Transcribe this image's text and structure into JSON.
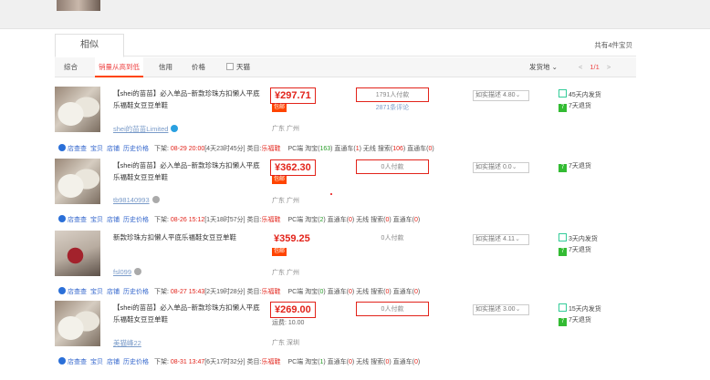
{
  "header": {
    "tab_similar": "相似",
    "total": "共有4件宝贝"
  },
  "sortbar": {
    "items": [
      "综合",
      "销量从高到低",
      "信用",
      "价格",
      "天猫"
    ],
    "ship_from": "发货地",
    "ship_caret": "⌄",
    "pager_prev": "<",
    "pager_current": "1/1",
    "pager_next": ">"
  },
  "items": [
    {
      "title": "【shei的苗苗】必入单品~新款珍珠方扣懒人平底乐福鞋女豆豆单鞋",
      "shop": "shei的苗苗Limited",
      "price": "¥297.71",
      "badge": "包邮",
      "location": "广东 广州",
      "sales": "1791人付款",
      "reviews": "2871条评论",
      "dsr": "如实描述 4.80",
      "services": [
        "45天内发货",
        "7天退货"
      ]
    },
    {
      "title": "【shei的苗苗】必入单品~新款珍珠方扣懒人平底乐福鞋女豆豆单鞋",
      "shop": "tb98140993",
      "price": "¥362.30",
      "badge": "包邮",
      "location": "广东 广州",
      "sales": "0人付款",
      "reviews": "",
      "dsr": "如实描述 0.0",
      "services": [
        "7天退货"
      ]
    },
    {
      "title": "新款珍珠方扣懒人平底乐福鞋女豆豆单鞋",
      "shop": "fsl099",
      "price": "¥359.25",
      "badge": "包邮",
      "location": "广东 广州",
      "sales": "0人付款",
      "reviews": "",
      "dsr": "如实描述 4.11",
      "services": [
        "3天内发货",
        "7天退货"
      ]
    },
    {
      "title": "【shei的苗苗】必入单品~新款珍珠方扣懒人平底乐福鞋女豆豆单鞋",
      "shop": "美猫峰22",
      "price": "¥269.00",
      "freight": "运费: 10.00",
      "location": "广东 深圳",
      "sales": "0人付款",
      "reviews": "",
      "dsr": "如实描述 3.00",
      "services": [
        "15天内发货",
        "7天退货"
      ]
    }
  ],
  "tools": {
    "labels": [
      "店查查",
      "宝贝",
      "店铺",
      "历史价格"
    ],
    "posted_label": "下架:",
    "category_label": "类目:",
    "category": "乐福鞋",
    "rows": [
      {
        "down_time": "08-29 20:00",
        "duration": "[4天23时45分]",
        "pc_label": "PC端 淘宝(",
        "pc_val": "163",
        "zt_label": ") 直通车(",
        "zt_val": "1",
        "ws_label": ") 无线 搜索(",
        "ws_val": "106",
        "ws_zt_label": ") 直通车(",
        "ws_zt_val": "0"
      },
      {
        "down_time": "08-26 15:12",
        "duration": "[1天18时57分]",
        "pc_label": "PC端 淘宝(",
        "pc_val": "2",
        "zt_label": ") 直通车(",
        "zt_val": "0",
        "ws_label": ") 无线 搜索(",
        "ws_val": "0",
        "ws_zt_label": ") 直通车(",
        "ws_zt_val": "0"
      },
      {
        "down_time": "08-27 15:43",
        "duration": "[2天19时28分]",
        "pc_label": "PC端 淘宝(",
        "pc_val": "0",
        "zt_label": ") 直通车(",
        "zt_val": "0",
        "ws_label": ") 无线 搜索(",
        "ws_val": "0",
        "ws_zt_label": ") 直通车(",
        "ws_zt_val": "0"
      },
      {
        "down_time": "08-31 13:47",
        "duration": "[6天17时32分]",
        "pc_label": "PC端 淘宝(",
        "pc_val": "1",
        "zt_label": ") 直通车(",
        "zt_val": "0",
        "ws_label": ") 无线 搜索(",
        "ws_val": "0",
        "ws_zt_label": ") 直通车(",
        "ws_zt_val": "0"
      }
    ]
  },
  "colors": {
    "accent": "#e2231a",
    "link": "#3366cc",
    "active_tab": "#ff4400"
  },
  "icons": {
    "ship": "truck-badge-icon",
    "return": "return-badge-icon",
    "wangwang": "wangwang-chat-icon",
    "tool": "info-circle-icon"
  }
}
